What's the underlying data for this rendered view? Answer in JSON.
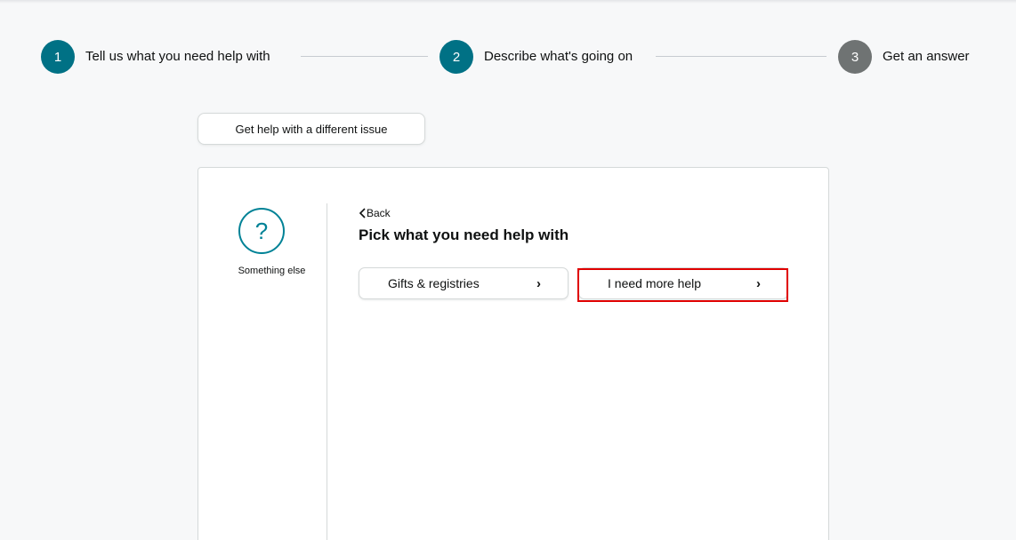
{
  "steps": [
    {
      "number": "1",
      "label": "Tell us what you need help with",
      "color": "#007185"
    },
    {
      "number": "2",
      "label": "Describe what's going on",
      "color": "#007185"
    },
    {
      "number": "3",
      "label": "Get an answer",
      "color": "#6f7373"
    }
  ],
  "different_issue_button": "Get help with a different issue",
  "sidebar": {
    "icon": "question-icon",
    "icon_glyph": "?",
    "label": "Something else"
  },
  "back_link": "Back",
  "heading": "Pick what you need help with",
  "options": [
    {
      "label": "Gifts & registries",
      "chevron": "›"
    },
    {
      "label": "I need more help",
      "chevron": "›"
    }
  ],
  "colors": {
    "accent": "#008296",
    "highlight": "#e00000"
  }
}
